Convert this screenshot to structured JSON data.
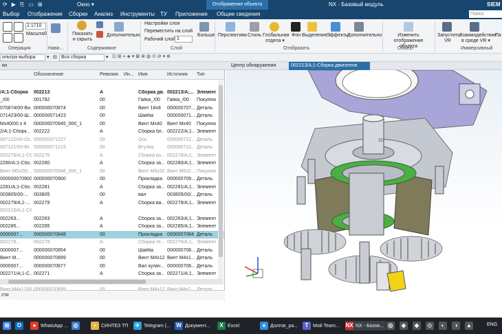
{
  "title_bar": {
    "quick_access": [
      "⟳",
      "▶",
      "⎘",
      "▭",
      "⊞"
    ],
    "window_menu": "Окно ▾",
    "context_tab": "Отображение объекта",
    "title": "NX - Базовый модуль",
    "brand": "SIEM"
  },
  "menu": {
    "items": [
      "Выбор",
      "Отображение",
      "Сборки",
      "Анализ",
      "Инструменты",
      "ТУ",
      "Приложение",
      "Общие сведения"
    ],
    "search_placeholder": "Поиск команды"
  },
  "ribbon": {
    "scale_value": "2.1710",
    "scale_label": "Масштаб",
    "show_hide": "Показать и скрыть",
    "more1": "Дополнительно",
    "layer_settings": "Настройки слоя",
    "move_to_layer": "Переместить на слой",
    "work_layer_label": "Рабочий слой",
    "work_layer_value": "1",
    "more_layer": "Больше",
    "perspective": "Перспектива",
    "style": "Стиль",
    "global_transparency": "Глобальная отдела ▾",
    "background": "Фон",
    "highlight": "Выделение",
    "effects": "Эффекты",
    "more2": "Дополнительно",
    "edit_display": "Изменить отображение объекта",
    "launch_vr": "Запустить VR",
    "vr_interaction": "Взаимодействие в среде VR ▾",
    "pa": "Па",
    "groups": [
      "Операция",
      "Нави...",
      "Содержимое",
      "Слой",
      "Отобразить",
      "Объект",
      "Иммерсивный"
    ]
  },
  "selection_bar": {
    "filter": "ильтра выбора",
    "assembly": "Вся сборка"
  },
  "tabs": {
    "navigator_label": "ки",
    "discovery": "Центр обнаружения",
    "active_tab": "002213/А;1-Сборка двигателя"
  },
  "navigator": {
    "columns": [
      "",
      "Обозначение",
      "Ревизия",
      "Ин...",
      "Имя",
      "Источник",
      "Тип"
    ],
    "rows": [
      {
        "c0": "",
        "c1": "",
        "c2": "",
        "c3": "",
        "c4": "",
        "c5": "",
        "style": "blank"
      },
      {
        "c0": "/А;1-Сборка",
        "c1": "002213",
        "c2": "A",
        "c3": "Сборка дв...",
        "c4": "002213/А;...",
        "c5": "Элемент",
        "style": "bold"
      },
      {
        "c0": "_/00",
        "c1": "001782",
        "c2": "00",
        "c3": "Гайка_/00",
        "c4": "Гайка_/00",
        "c5": "Покупнов",
        "style": ""
      },
      {
        "c0": "070874/00-Ви...",
        "c1": "000000070874",
        "c2": "00",
        "c3": "Винт 18x8",
        "c4": "000000707...",
        "c5": "Деталь",
        "style": ""
      },
      {
        "c0": "071423/00-Ш...",
        "c1": "000000071423",
        "c2": "00",
        "c3": "Шайба",
        "c4": "000000071...",
        "c5": "Деталь",
        "style": ""
      },
      {
        "c0": "Mx40/00 x 4",
        "c1": "000000070945_000_1",
        "c2": "00",
        "c3": "Винт Mx40",
        "c4": "Винт Mx40",
        "c5": "Покупнов",
        "style": ""
      },
      {
        "c0": "2/А;1-Сборк...",
        "c1": "002222",
        "c2": "A",
        "c3": "Сборка бл...",
        "c4": "002222/А;1...",
        "c5": "Элемент",
        "style": ""
      },
      {
        "c0": "007122/00-Ос...",
        "c1": "000000071227",
        "c2": "00",
        "c3": "Ось",
        "c4": "000000712...",
        "c5": "Деталь",
        "style": "gray"
      },
      {
        "c0": "007121/00-Вт...",
        "c1": "000000071219",
        "c2": "00",
        "c3": "Втулка",
        "c4": "000000712...",
        "c5": "Деталь",
        "style": "gray"
      },
      {
        "c0": "002276/А;1-Сбо...",
        "c1": "002276",
        "c2": "A",
        "c3": "Сборка ко...",
        "c4": "002276/А;1...",
        "c5": "Элемент",
        "style": "gray"
      },
      {
        "c0": "2280/А;1-Сбо...",
        "c1": "002280",
        "c2": "A",
        "c3": "Сборка за...",
        "c4": "002280/А;1...",
        "c5": "Элемент",
        "style": ""
      },
      {
        "c0": "Винт M5x20/...",
        "c1": "000000070946_000_1",
        "c2": "00",
        "c3": "Винт M5x20",
        "c4": "Винт M5x2...",
        "c5": "Покупнов",
        "style": "gray"
      },
      {
        "c0": "000000070900/...",
        "c1": "000000070900",
        "c2": "00",
        "c3": "Прокладка",
        "c4": "000000709...",
        "c5": "Деталь",
        "style": ""
      },
      {
        "c0": "2281/А;1-Сбо...",
        "c1": "002281",
        "c2": "A",
        "c3": "Сборка за...",
        "c4": "002281/А;1...",
        "c5": "Элемент",
        "style": ""
      },
      {
        "c0": "003805/00-...",
        "c1": "003805",
        "c2": "00",
        "c3": "вал",
        "c4": "003805/00/...",
        "c5": "Деталь",
        "style": ""
      },
      {
        "c0": "002279/А;1-...",
        "c1": "002279",
        "c2": "A",
        "c3": "Сборка ва...",
        "c4": "002279/А;1...",
        "c5": "Элемент",
        "style": ""
      },
      {
        "c0": "002215/А;1-Сборка поршня",
        "c1": "",
        "c2": "",
        "c3": "",
        "c4": "",
        "c5": "",
        "style": "gray"
      },
      {
        "c0": "002263...",
        "c1": "002263",
        "c2": "A",
        "c3": "Сборка за...",
        "c4": "002263/А;1...",
        "c5": "Элемент",
        "style": ""
      },
      {
        "c0": "002285...",
        "c1": "002285",
        "c2": "A",
        "c3": "Сборка за...",
        "c4": "002285/А;1...",
        "c5": "Элемент",
        "style": ""
      },
      {
        "c0": "0000007...",
        "c1": "000000070848",
        "c2": "00",
        "c3": "Прокладка",
        "c4": "0000007084...",
        "c5": "Деталь",
        "style": "sel"
      },
      {
        "c0": "002278...",
        "c1": "002278",
        "c2": "A",
        "c3": "Сборка те...",
        "c4": "002278/А;1...",
        "c5": "Элемент",
        "style": "gray"
      },
      {
        "c0": "0000007...",
        "c1": "000000070854",
        "c2": "00",
        "c3": "Шайба",
        "c4": "000000708...",
        "c5": "Деталь",
        "style": ""
      },
      {
        "c0": "Винт M...",
        "c1": "000000070899",
        "c2": "00",
        "c3": "Винт M4x12",
        "c4": "Винт M4x1...",
        "c5": "Деталь",
        "style": ""
      },
      {
        "c0": "0000007...",
        "c1": "000000070877",
        "c2": "00",
        "c3": "Вал кулач...",
        "c4": "000000708...",
        "c5": "Деталь",
        "style": ""
      },
      {
        "c0": "002271/А;1-С...",
        "c1": "002271",
        "c2": "A",
        "c3": "Сборка за...",
        "c4": "002271/А;1...",
        "c5": "Элемент",
        "style": ""
      },
      {
        "c0": "002275/А;1-Пла...",
        "c1": "002275",
        "c2": "A",
        "c3": "Сборка пл...",
        "c4": "002275/А;1...",
        "c5": "Элемент",
        "style": "gray"
      },
      {
        "c0": "Винт M4x12/00...",
        "c1": "000000070899",
        "c2": "00",
        "c3": "Винт M4x12",
        "c4": "Винт M4x1...",
        "c5": "Деталь",
        "style": "gray"
      },
      {
        "c0": "000000070813...",
        "c1": "000000070813",
        "c2": "00",
        "c3": "Шпонка",
        "c4": "000000708...",
        "c5": "Деталь",
        "style": "gray"
      }
    ]
  },
  "subpanel": {
    "label": "сти"
  },
  "viewport": {
    "axis_label": "ZC"
  },
  "taskbar": {
    "items": [
      {
        "label": "",
        "color": "#0f6cbd",
        "glyph": "O"
      },
      {
        "label": "WhatsApp ...",
        "color": "#e33b2e",
        "glyph": "●"
      },
      {
        "label": "",
        "color": "#3a7bd5",
        "glyph": "◎"
      },
      {
        "label": "СИНТЕЗ ТП",
        "color": "#e8b44a",
        "glyph": "▪"
      },
      {
        "label": "Telegram (...",
        "color": "#2aa1da",
        "glyph": "✈"
      },
      {
        "label": "Документ...",
        "color": "#2b5fb4",
        "glyph": "W"
      },
      {
        "label": "Excel",
        "color": "#1e7a45",
        "glyph": "X"
      },
      {
        "label": "Долгов_ра...",
        "color": "#2c8fd8",
        "glyph": "e"
      },
      {
        "label": "Мой Team...",
        "color": "#5b5fc7",
        "glyph": "T"
      },
      {
        "label": "NX - Базов...",
        "color": "#c92b2b",
        "glyph": "NX"
      }
    ],
    "tray": "ENG"
  }
}
